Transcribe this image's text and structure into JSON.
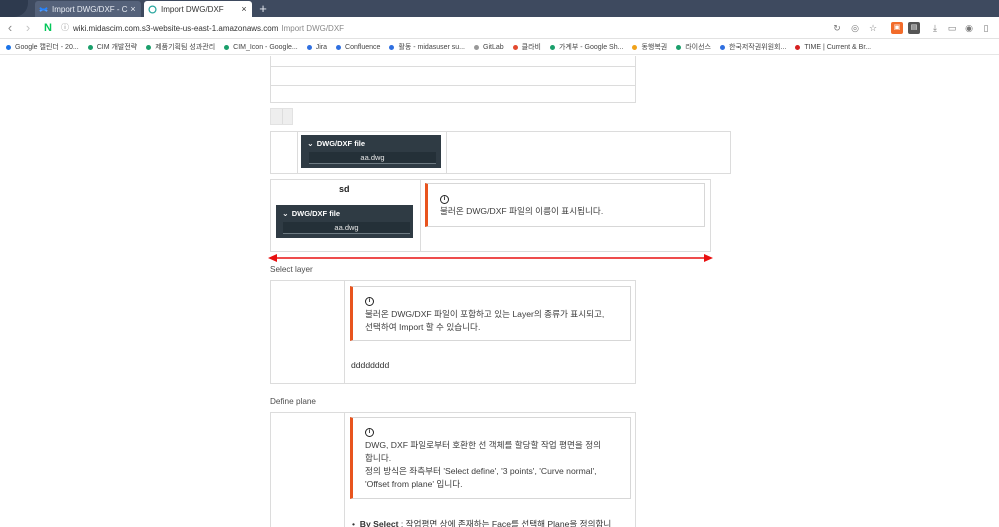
{
  "browser": {
    "tabs": [
      {
        "title": "Import DWG/DXF - CIM P",
        "active": false
      },
      {
        "title": "Import DWG/DXF",
        "active": true
      }
    ],
    "new_tab": "+",
    "tab_close": "×",
    "nav": {
      "back": "‹",
      "forward": "›",
      "naver": "N"
    },
    "url_host": "wiki.midascim.com.s3-website-us-east-1.amazonaws.com",
    "url_title": "Import DWG/DXF",
    "bookmarks": [
      {
        "label": "Google 캘린더 - 20...",
        "color": "#1a73e8"
      },
      {
        "label": "CIM 개발전략",
        "color": "#1a9f6b"
      },
      {
        "label": "제품기획팀 성과관리",
        "color": "#1a9f6b"
      },
      {
        "label": "CIM_Icon - Google...",
        "color": "#1a9f6b"
      },
      {
        "label": "Jira",
        "color": "#2f6fe0"
      },
      {
        "label": "Confluence",
        "color": "#2f6fe0"
      },
      {
        "label": "활동 - midasuser su...",
        "color": "#2f6fe0"
      },
      {
        "label": "GitLab",
        "color": "#999999"
      },
      {
        "label": "클라비",
        "color": "#e34a2f"
      },
      {
        "label": "가계부 - Google Sh...",
        "color": "#1a9f6b"
      },
      {
        "label": "동행복권",
        "color": "#f0a21a"
      },
      {
        "label": "라이선스",
        "color": "#1a9f6b"
      },
      {
        "label": "한국저작권위원회...",
        "color": "#2f6fe0"
      },
      {
        "label": "TIME | Current & Br...",
        "color": "#d62020"
      }
    ]
  },
  "content": {
    "dwg_panel_1": {
      "header": "DWG/DXF file",
      "value": "aa.dwg"
    },
    "sd_cell": {
      "heading": "sd"
    },
    "dwg_panel_2": {
      "header": "DWG/DXF file",
      "value": "aa.dwg"
    },
    "note_filename": {
      "icon": "i",
      "text": "불러온 DWG/DXF 파일의 이름이 표시됩니다."
    },
    "select_layer": {
      "label": "Select layer",
      "note_icon": "i",
      "note_line1": "불러온 DWG/DXF 파일이 포함하고 있는 Layer의 종류가 표시되고,",
      "note_line2": "선택하여 Import 할 수 있습니다.",
      "text": "dddddddd"
    },
    "define_plane": {
      "label": "Define plane",
      "note_icon": "i",
      "note_line1": "DWG, DXF 파일로부터 호환한 선 객체를 할당할 작업 평면을 정의",
      "note_line2": "합니다.",
      "note_line3": "정의 방식은 좌측부터 'Select define', '3 points', 'Curve normal',",
      "note_line4": "'Offset from plane' 입니다.",
      "bullet_bold": "By Select",
      "bullet_rest": " : 작업평면 상에 존재하는 Face를 선택해 Plane을 정의합니"
    }
  },
  "annotation": {
    "arrow_color": "#e81010",
    "accent_color": "#e8541e"
  }
}
